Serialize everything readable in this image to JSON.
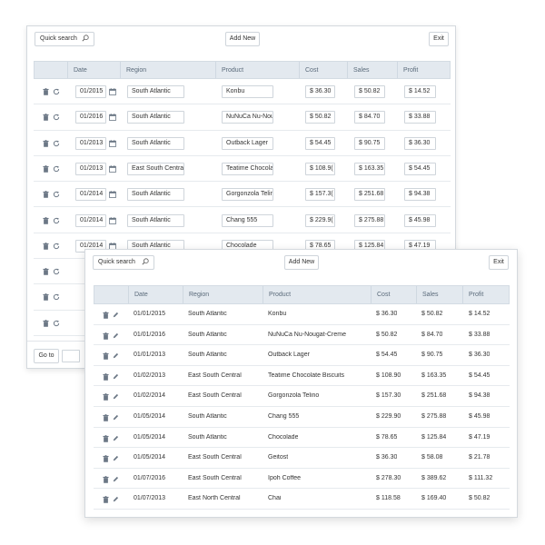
{
  "toolbar": {
    "search_placeholder": "Quick search",
    "add_new_label": "Add New",
    "exit_label": "Exit"
  },
  "columns": {
    "date": "Date",
    "region": "Region",
    "product": "Product",
    "cost": "Cost",
    "sales": "Sales",
    "profit": "Profit"
  },
  "back_rows": [
    {
      "date": "01/2015",
      "region": "South Atlantic",
      "product": "Konbu",
      "cost": "$ 36.30",
      "sales": "$ 50.82",
      "profit": "$ 14.52"
    },
    {
      "date": "01/2016",
      "region": "South Atlantic",
      "product": "NuNuCa Nu-Nou",
      "cost": "$ 50.82",
      "sales": "$ 84.70",
      "profit": "$ 33.88"
    },
    {
      "date": "01/2013",
      "region": "South Atlantic",
      "product": "Outback Lager",
      "cost": "$ 54.45",
      "sales": "$ 90.75",
      "profit": "$ 36.30"
    },
    {
      "date": "01/2013",
      "region": "East South Central",
      "product": "Teatime Chocola",
      "cost": "$ 108.9(",
      "sales": "$ 163.35",
      "profit": "$ 54.45"
    },
    {
      "date": "01/2014",
      "region": "South Atlantic",
      "product": "Gorgonzola Telin",
      "cost": "$ 157.3(",
      "sales": "$ 251.68",
      "profit": "$ 94.38"
    },
    {
      "date": "01/2014",
      "region": "South Atlantic",
      "product": "Chang 555",
      "cost": "$ 229.9(",
      "sales": "$ 275.88",
      "profit": "$ 45.98"
    },
    {
      "date": "01/2014",
      "region": "South Atlantic",
      "product": "Chocolade",
      "cost": "$ 78.65",
      "sales": "$ 125.84",
      "profit": "$ 47.19"
    }
  ],
  "back_footer": {
    "goto_label": "Go to"
  },
  "front_rows": [
    {
      "date": "01/01/2015",
      "region": "South Atlantic",
      "product": "Konbu",
      "cost": "$ 36.30",
      "sales": "$ 50.82",
      "profit": "$ 14.52"
    },
    {
      "date": "01/01/2016",
      "region": "South Atlantic",
      "product": "NuNuCa Nu-Nougat-Creme",
      "cost": "$ 50.82",
      "sales": "$ 84.70",
      "profit": "$ 33.88"
    },
    {
      "date": "01/01/2013",
      "region": "South Atlantic",
      "product": "Outback Lager",
      "cost": "$ 54.45",
      "sales": "$ 90.75",
      "profit": "$ 36.30"
    },
    {
      "date": "01/02/2013",
      "region": "East South Central",
      "product": "Teatime Chocolate Biscuits",
      "cost": "$ 108.90",
      "sales": "$ 163.35",
      "profit": "$ 54.45"
    },
    {
      "date": "01/02/2014",
      "region": "East South Central",
      "product": "Gorgonzola Telino",
      "cost": "$ 157.30",
      "sales": "$ 251.68",
      "profit": "$ 94.38"
    },
    {
      "date": "01/05/2014",
      "region": "South Atlantic",
      "product": "Chang 555",
      "cost": "$ 229.90",
      "sales": "$ 275.88",
      "profit": "$ 45.98"
    },
    {
      "date": "01/05/2014",
      "region": "South Atlantic",
      "product": "Chocolade",
      "cost": "$ 78.65",
      "sales": "$ 125.84",
      "profit": "$ 47.19"
    },
    {
      "date": "01/05/2014",
      "region": "East South Central",
      "product": "Geitost",
      "cost": "$ 36.30",
      "sales": "$ 58.08",
      "profit": "$ 21.78"
    },
    {
      "date": "01/07/2016",
      "region": "East South Central",
      "product": "Ipoh Coffee",
      "cost": "$ 278.30",
      "sales": "$ 389.62",
      "profit": "$ 111.32"
    },
    {
      "date": "01/07/2013",
      "region": "East North Central",
      "product": "Chai",
      "cost": "$ 118.58",
      "sales": "$ 169.40",
      "profit": "$ 50.82"
    }
  ],
  "icons": {
    "trash": "trash-icon",
    "refresh": "refresh-icon",
    "edit": "pencil-icon",
    "calendar": "calendar-icon",
    "search": "search-icon"
  },
  "colors": {
    "header_bg": "#e3e9ef",
    "icon": "#6b7785"
  }
}
